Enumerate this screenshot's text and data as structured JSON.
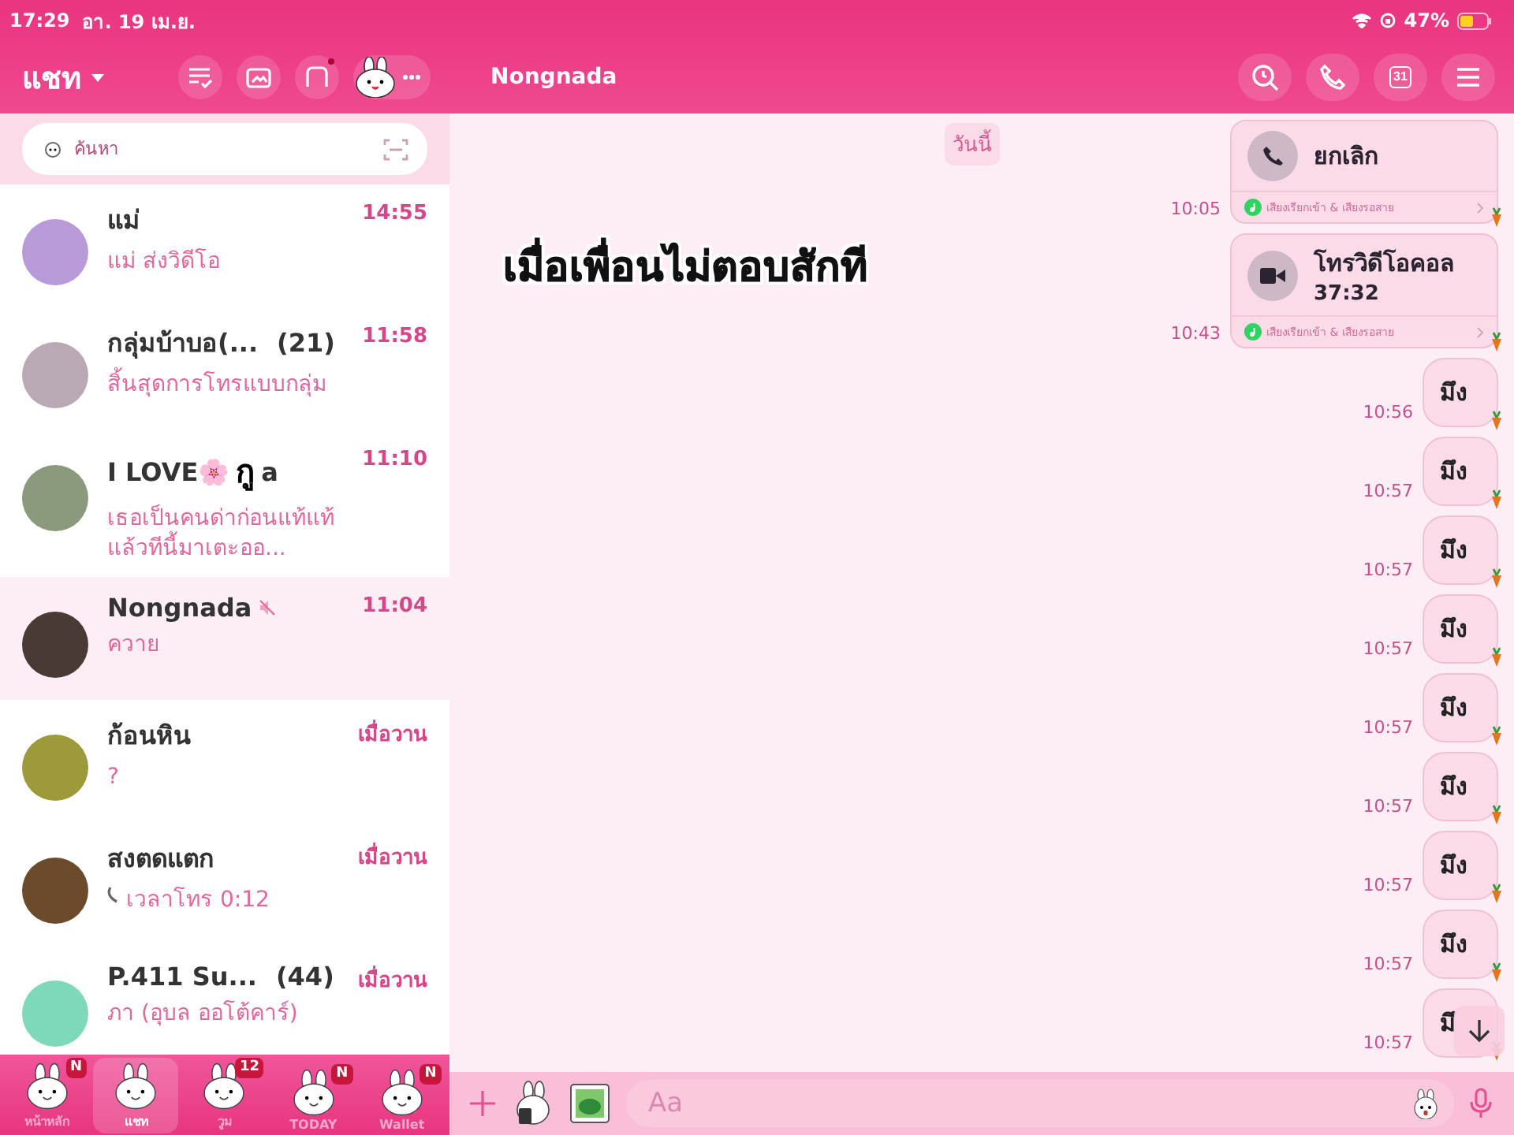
{
  "status_bar": {
    "time": "17:29",
    "date": "อา. 19 เม.ย.",
    "battery": "47%"
  },
  "sidebar": {
    "title": "แชท",
    "search": {
      "placeholder": "ค้นหา"
    },
    "chats": [
      {
        "name": "แม่",
        "preview": "แม่ ส่งวิดีโอ",
        "time": "14:55",
        "selected": false,
        "muted": false,
        "call": false
      },
      {
        "name": "กลุ่มบ้าบอ(...",
        "count": "(21)",
        "preview": "สิ้นสุดการโทรแบบกลุ่ม",
        "time": "11:58",
        "selected": false,
        "muted": false,
        "call": false
      },
      {
        "name": "I LOVE🌸",
        "overlay": "กู",
        "name_tail": "a",
        "preview": "เธอเป็นคนด่าก่อนแท้แท้แล้วทีนี้มาเตะออ...",
        "time": "11:10",
        "selected": false,
        "muted": false,
        "call": false
      },
      {
        "name": "Nongnada",
        "preview": "ควาย",
        "time": "11:04",
        "selected": true,
        "muted": true,
        "call": false
      },
      {
        "name": "ก้อนหิน",
        "preview": "?",
        "time": "เมื่อวาน",
        "selected": false,
        "muted": false,
        "call": false
      },
      {
        "name": "สงตดแตก",
        "preview": "เวลาโทร 0:12",
        "time": "เมื่อวาน",
        "selected": false,
        "muted": false,
        "call": true
      },
      {
        "name": "P.411 Su...",
        "count": "(44)",
        "preview": "ภา (อุบล ออโต้คาร์)",
        "time": "เมื่อวาน",
        "selected": false,
        "muted": false,
        "call": false
      }
    ],
    "tabs": [
      {
        "label": "หน้าหลัก",
        "badge": "N",
        "selected": false
      },
      {
        "label": "แชท",
        "selected": true
      },
      {
        "label": "วูม",
        "badge": "12",
        "selected": false
      },
      {
        "label": "TODAY",
        "badge": "N",
        "selected": false
      },
      {
        "label": "Wallet",
        "badge": "N",
        "selected": false
      }
    ]
  },
  "chat": {
    "title": "Nongnada",
    "calendar_day": "31",
    "date_chip": "วันนี้",
    "caption": "เมื่อเพื่อนไม่ตอบสักที",
    "messages": [
      {
        "kind": "voice_call",
        "title": "ยกเลิก",
        "footer": "เสียงเรียกเข้า & เสียงรอสาย",
        "time": "10:05"
      },
      {
        "kind": "video_call",
        "title": "โทรวิดีโอคอล",
        "duration": "37:32",
        "footer": "เสียงเรียกเข้า & เสียงรอสาย",
        "time": "10:43"
      },
      {
        "kind": "text",
        "text": "มึง",
        "time": "10:56"
      },
      {
        "kind": "text",
        "text": "มึง",
        "time": "10:57"
      },
      {
        "kind": "text",
        "text": "มึง",
        "time": "10:57"
      },
      {
        "kind": "text",
        "text": "มึง",
        "time": "10:57"
      },
      {
        "kind": "text",
        "text": "มึง",
        "time": "10:57"
      },
      {
        "kind": "text",
        "text": "มึง",
        "time": "10:57"
      },
      {
        "kind": "text",
        "text": "มึง",
        "time": "10:57"
      },
      {
        "kind": "text",
        "text": "มึง",
        "time": "10:57"
      },
      {
        "kind": "text",
        "text": "มึ",
        "time": "10:57"
      }
    ],
    "input": {
      "placeholder": "Aa"
    }
  }
}
